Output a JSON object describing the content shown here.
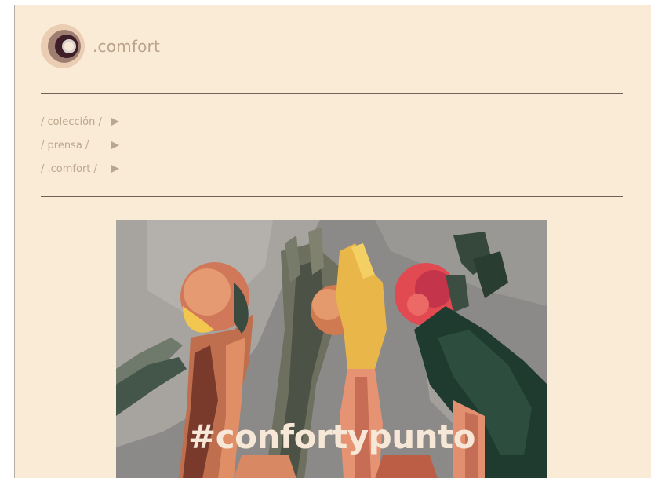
{
  "brand": {
    "name": ".comfort",
    "logo_icon": "concentric-circles-logo",
    "colors": {
      "outer": "#eacdb3",
      "ring": "#9e7e70",
      "dark": "#3c1d28",
      "core": "#f6e7d6"
    }
  },
  "nav": {
    "items": [
      {
        "label": "/ colección /",
        "icon": "play-arrow-icon"
      },
      {
        "label": "/ prensa /",
        "icon": "play-arrow-icon"
      },
      {
        "label": "/ .comfort /",
        "icon": "play-arrow-icon"
      }
    ]
  },
  "hero": {
    "caption": "#confortypunto",
    "image_subject": "raised hands holding fruit and a flower in posterized colors"
  },
  "theme": {
    "background": "#faebd7",
    "nav_text": "#bda78d",
    "rule": "#6e6259"
  }
}
